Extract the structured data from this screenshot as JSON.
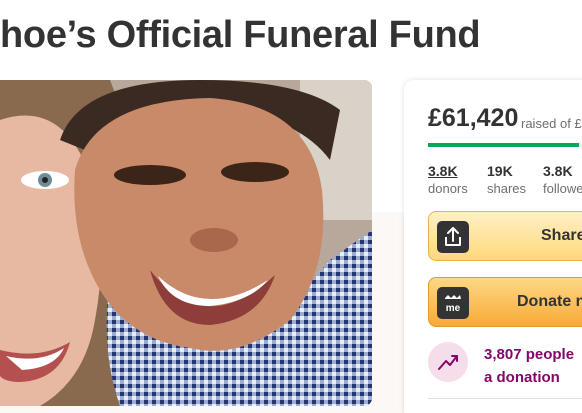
{
  "campaign": {
    "title": "hoe’s Official Funeral Fund"
  },
  "photo": {
    "icon": "campaign-photo"
  },
  "donation_card": {
    "amount": "£61,420",
    "raised_text": "raised of £",
    "progress_fraction": 0.98,
    "accent_color": "#02a95c",
    "stats": [
      {
        "value": "3.8K",
        "label": "donors"
      },
      {
        "value": "19K",
        "label": "shares"
      },
      {
        "value": "3.8K",
        "label": "followe"
      }
    ],
    "share_button": {
      "label": "Share",
      "icon": "share-upload-icon"
    },
    "donate_button": {
      "label": "Donate n",
      "icon": "donate-me-icon"
    },
    "trend": {
      "icon": "trending-up-icon",
      "line1": "3,807 people",
      "line2": "a donation",
      "color": "#85066b"
    }
  }
}
